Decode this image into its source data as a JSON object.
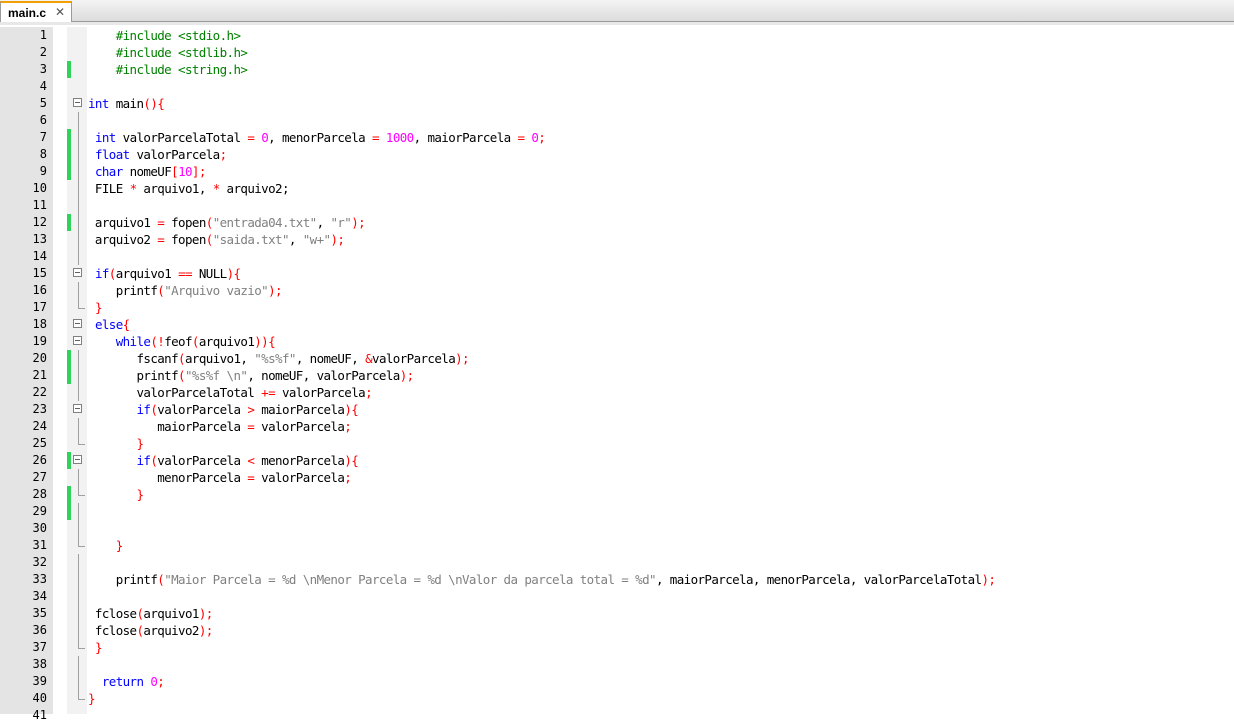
{
  "tab": {
    "title": "main.c",
    "close_glyph": "✕"
  },
  "colors": {
    "keyword": "#0000ff",
    "preprocessor": "#008000",
    "string": "#808080",
    "number": "#ff00ff",
    "operator": "#ff0000",
    "text": "#000000",
    "change_marker": "#2fd35a"
  },
  "editor": {
    "lines": [
      {
        "n": "1",
        "change": false,
        "fold": "none",
        "tokens": [
          [
            "    ",
            "t"
          ],
          [
            "#include <stdio.h>",
            "p"
          ]
        ]
      },
      {
        "n": "2",
        "change": false,
        "fold": "none",
        "tokens": [
          [
            "    ",
            "t"
          ],
          [
            "#include <stdlib.h>",
            "p"
          ]
        ]
      },
      {
        "n": "3",
        "change": true,
        "fold": "none",
        "tokens": [
          [
            "    ",
            "t"
          ],
          [
            "#include <string.h>",
            "p"
          ]
        ]
      },
      {
        "n": "4",
        "change": false,
        "fold": "none",
        "tokens": []
      },
      {
        "n": "5",
        "change": false,
        "fold": "start",
        "tokens": [
          [
            "int",
            "k"
          ],
          [
            " main",
            "t"
          ],
          [
            "(){",
            "o"
          ]
        ]
      },
      {
        "n": "6",
        "change": false,
        "fold": "line",
        "tokens": []
      },
      {
        "n": "7",
        "change": true,
        "fold": "line",
        "tokens": [
          [
            " ",
            "t"
          ],
          [
            "int",
            "k"
          ],
          [
            " valorParcelaTotal ",
            "t"
          ],
          [
            "=",
            "o"
          ],
          [
            " ",
            "t"
          ],
          [
            "0",
            "n"
          ],
          [
            ", menorParcela ",
            "t"
          ],
          [
            "=",
            "o"
          ],
          [
            " ",
            "t"
          ],
          [
            "1000",
            "n"
          ],
          [
            ", maiorParcela ",
            "t"
          ],
          [
            "=",
            "o"
          ],
          [
            " ",
            "t"
          ],
          [
            "0",
            "n"
          ],
          [
            ";",
            "o"
          ]
        ]
      },
      {
        "n": "8",
        "change": true,
        "fold": "line",
        "tokens": [
          [
            " ",
            "t"
          ],
          [
            "float",
            "k"
          ],
          [
            " valorParcela",
            "t"
          ],
          [
            ";",
            "o"
          ]
        ]
      },
      {
        "n": "9",
        "change": true,
        "fold": "line",
        "tokens": [
          [
            " ",
            "t"
          ],
          [
            "char",
            "k"
          ],
          [
            " nomeUF",
            "t"
          ],
          [
            "[",
            "o"
          ],
          [
            "10",
            "n"
          ],
          [
            "];",
            "o"
          ]
        ]
      },
      {
        "n": "10",
        "change": false,
        "fold": "line",
        "tokens": [
          [
            " FILE ",
            "t"
          ],
          [
            "*",
            "o"
          ],
          [
            " arquivo1, ",
            "t"
          ],
          [
            "*",
            "o"
          ],
          [
            " arquivo2;",
            "t"
          ]
        ]
      },
      {
        "n": "11",
        "change": false,
        "fold": "line",
        "tokens": []
      },
      {
        "n": "12",
        "change": true,
        "fold": "line",
        "tokens": [
          [
            " arquivo1 ",
            "t"
          ],
          [
            "=",
            "o"
          ],
          [
            " fopen",
            "t"
          ],
          [
            "(",
            "o"
          ],
          [
            "\"entrada04.txt\"",
            "s"
          ],
          [
            ", ",
            "t"
          ],
          [
            "\"r\"",
            "s"
          ],
          [
            ");",
            "o"
          ]
        ]
      },
      {
        "n": "13",
        "change": false,
        "fold": "line",
        "tokens": [
          [
            " arquivo2 ",
            "t"
          ],
          [
            "=",
            "o"
          ],
          [
            " fopen",
            "t"
          ],
          [
            "(",
            "o"
          ],
          [
            "\"saida.txt\"",
            "s"
          ],
          [
            ", ",
            "t"
          ],
          [
            "\"w+\"",
            "s"
          ],
          [
            ");",
            "o"
          ]
        ]
      },
      {
        "n": "14",
        "change": false,
        "fold": "line",
        "tokens": []
      },
      {
        "n": "15",
        "change": false,
        "fold": "start",
        "tokens": [
          [
            " ",
            "t"
          ],
          [
            "if",
            "k"
          ],
          [
            "(",
            "o"
          ],
          [
            "arquivo1 ",
            "t"
          ],
          [
            "==",
            "o"
          ],
          [
            " NULL",
            "t"
          ],
          [
            "){",
            "o"
          ]
        ]
      },
      {
        "n": "16",
        "change": false,
        "fold": "line",
        "tokens": [
          [
            "    printf",
            "t"
          ],
          [
            "(",
            "o"
          ],
          [
            "\"Arquivo vazio\"",
            "s"
          ],
          [
            ");",
            "o"
          ]
        ]
      },
      {
        "n": "17",
        "change": false,
        "fold": "end",
        "tokens": [
          [
            " ",
            "t"
          ],
          [
            "}",
            "o"
          ]
        ]
      },
      {
        "n": "18",
        "change": false,
        "fold": "start",
        "tokens": [
          [
            " ",
            "t"
          ],
          [
            "else",
            "k"
          ],
          [
            "{",
            "o"
          ]
        ]
      },
      {
        "n": "19",
        "change": false,
        "fold": "start",
        "tokens": [
          [
            "    ",
            "t"
          ],
          [
            "while",
            "k"
          ],
          [
            "(!",
            "o"
          ],
          [
            "feof",
            "t"
          ],
          [
            "(",
            "o"
          ],
          [
            "arquivo1",
            "t"
          ],
          [
            ")){",
            "o"
          ]
        ]
      },
      {
        "n": "20",
        "change": true,
        "fold": "line",
        "tokens": [
          [
            "       fscanf",
            "t"
          ],
          [
            "(",
            "o"
          ],
          [
            "arquivo1, ",
            "t"
          ],
          [
            "\"%s%f\"",
            "s"
          ],
          [
            ", nomeUF, ",
            "t"
          ],
          [
            "&",
            "o"
          ],
          [
            "valorParcela",
            "t"
          ],
          [
            ");",
            "o"
          ]
        ]
      },
      {
        "n": "21",
        "change": true,
        "fold": "line",
        "tokens": [
          [
            "       printf",
            "t"
          ],
          [
            "(",
            "o"
          ],
          [
            "\"%s%f \\n\"",
            "s"
          ],
          [
            ", nomeUF, valorParcela",
            "t"
          ],
          [
            ");",
            "o"
          ]
        ]
      },
      {
        "n": "22",
        "change": false,
        "fold": "line",
        "tokens": [
          [
            "       valorParcelaTotal ",
            "t"
          ],
          [
            "+=",
            "o"
          ],
          [
            " valorParcela",
            "t"
          ],
          [
            ";",
            "o"
          ]
        ]
      },
      {
        "n": "23",
        "change": false,
        "fold": "start",
        "tokens": [
          [
            "       ",
            "t"
          ],
          [
            "if",
            "k"
          ],
          [
            "(",
            "o"
          ],
          [
            "valorParcela ",
            "t"
          ],
          [
            ">",
            "o"
          ],
          [
            " maiorParcela",
            "t"
          ],
          [
            "){",
            "o"
          ]
        ]
      },
      {
        "n": "24",
        "change": false,
        "fold": "line",
        "tokens": [
          [
            "          maiorParcela ",
            "t"
          ],
          [
            "=",
            "o"
          ],
          [
            " valorParcela",
            "t"
          ],
          [
            ";",
            "o"
          ]
        ]
      },
      {
        "n": "25",
        "change": false,
        "fold": "end",
        "tokens": [
          [
            "       ",
            "t"
          ],
          [
            "}",
            "o"
          ]
        ]
      },
      {
        "n": "26",
        "change": true,
        "fold": "start",
        "tokens": [
          [
            "       ",
            "t"
          ],
          [
            "if",
            "k"
          ],
          [
            "(",
            "o"
          ],
          [
            "valorParcela ",
            "t"
          ],
          [
            "<",
            "o"
          ],
          [
            " menorParcela",
            "t"
          ],
          [
            "){",
            "o"
          ]
        ]
      },
      {
        "n": "27",
        "change": false,
        "fold": "line",
        "tokens": [
          [
            "          menorParcela ",
            "t"
          ],
          [
            "=",
            "o"
          ],
          [
            " valorParcela",
            "t"
          ],
          [
            ";",
            "o"
          ]
        ]
      },
      {
        "n": "28",
        "change": true,
        "fold": "end",
        "tokens": [
          [
            "       ",
            "t"
          ],
          [
            "}",
            "o"
          ]
        ]
      },
      {
        "n": "29",
        "change": true,
        "fold": "line",
        "tokens": []
      },
      {
        "n": "30",
        "change": false,
        "fold": "line",
        "tokens": []
      },
      {
        "n": "31",
        "change": false,
        "fold": "end",
        "tokens": [
          [
            "    ",
            "t"
          ],
          [
            "}",
            "o"
          ]
        ]
      },
      {
        "n": "32",
        "change": false,
        "fold": "line",
        "tokens": []
      },
      {
        "n": "33",
        "change": false,
        "fold": "line",
        "tokens": [
          [
            "    printf",
            "t"
          ],
          [
            "(",
            "o"
          ],
          [
            "\"Maior Parcela = %d \\nMenor Parcela = %d \\nValor da parcela total = %d\"",
            "s"
          ],
          [
            ", maiorParcela, menorParcela, valorParcelaTotal",
            "t"
          ],
          [
            ");",
            "o"
          ]
        ]
      },
      {
        "n": "34",
        "change": false,
        "fold": "line",
        "tokens": []
      },
      {
        "n": "35",
        "change": false,
        "fold": "line",
        "tokens": [
          [
            " fclose",
            "t"
          ],
          [
            "(",
            "o"
          ],
          [
            "arquivo1",
            "t"
          ],
          [
            ");",
            "o"
          ]
        ]
      },
      {
        "n": "36",
        "change": false,
        "fold": "line",
        "tokens": [
          [
            " fclose",
            "t"
          ],
          [
            "(",
            "o"
          ],
          [
            "arquivo2",
            "t"
          ],
          [
            ");",
            "o"
          ]
        ]
      },
      {
        "n": "37",
        "change": false,
        "fold": "end",
        "tokens": [
          [
            " ",
            "t"
          ],
          [
            "}",
            "o"
          ]
        ]
      },
      {
        "n": "38",
        "change": false,
        "fold": "line",
        "tokens": []
      },
      {
        "n": "39",
        "change": false,
        "fold": "line",
        "tokens": [
          [
            "  ",
            "t"
          ],
          [
            "return",
            "k"
          ],
          [
            " ",
            "t"
          ],
          [
            "0",
            "n"
          ],
          [
            ";",
            "o"
          ]
        ]
      },
      {
        "n": "40",
        "change": false,
        "fold": "end",
        "tokens": [
          [
            "}",
            "o"
          ]
        ]
      },
      {
        "n": "41",
        "change": false,
        "fold": "none",
        "tokens": []
      }
    ]
  }
}
